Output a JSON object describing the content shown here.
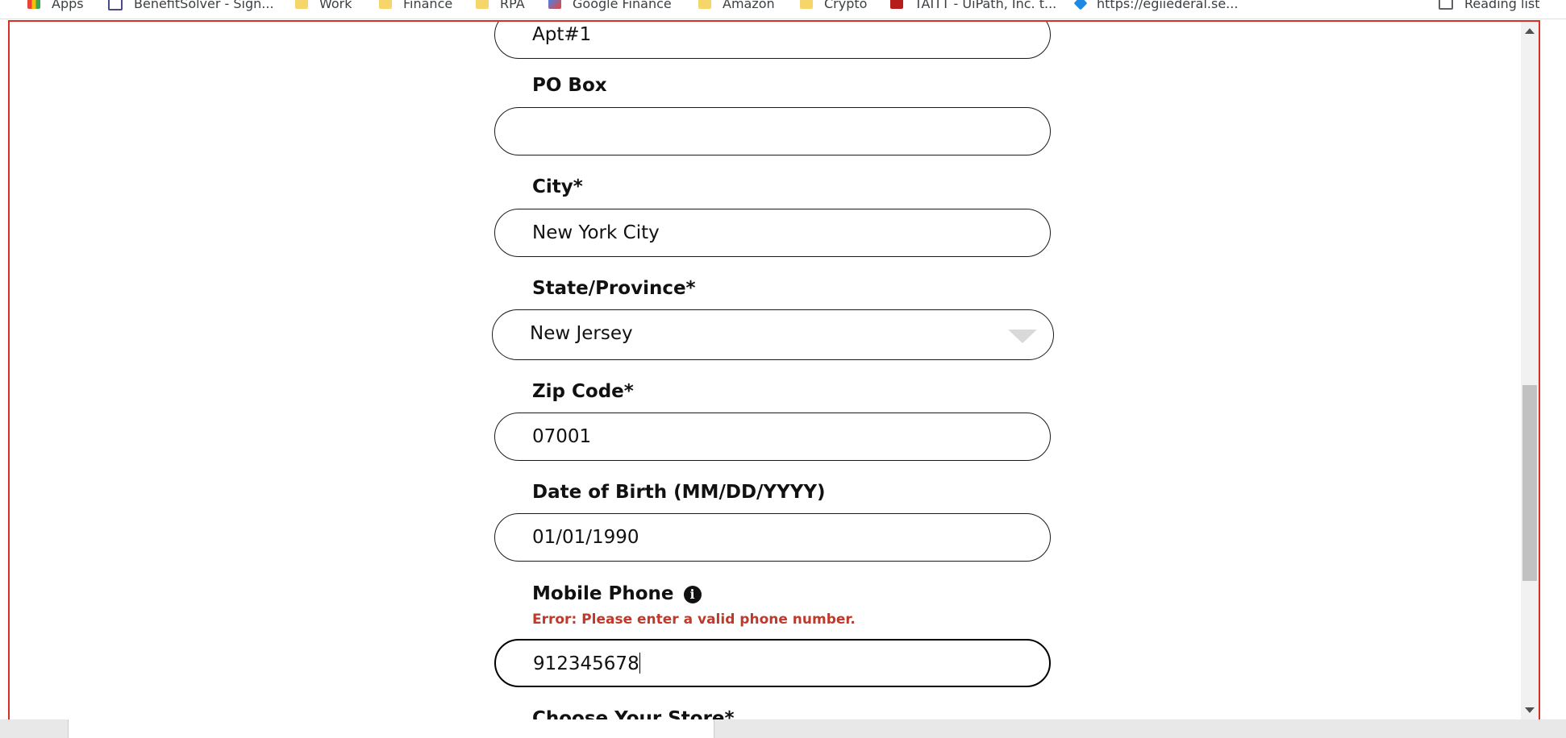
{
  "bookmarks": [
    {
      "label": "Apps",
      "icon": "apps-grid-icon"
    },
    {
      "label": "BenefitSolver - Sign...",
      "icon": "benefitsolver-icon"
    },
    {
      "label": "Work",
      "icon": "folder-icon"
    },
    {
      "label": "Finance",
      "icon": "folder-icon"
    },
    {
      "label": "RPA",
      "icon": "folder-icon"
    },
    {
      "label": "Google Finance",
      "icon": "google-finance-icon"
    },
    {
      "label": "Amazon",
      "icon": "folder-icon"
    },
    {
      "label": "Crypto",
      "icon": "folder-icon"
    },
    {
      "label": "TAITT - UiPath, Inc. t...",
      "icon": "tax-site-icon"
    },
    {
      "label": "https://egiiederal.se...",
      "icon": "federal-site-icon"
    },
    {
      "label": "Reading list",
      "icon": "reading-list-icon"
    }
  ],
  "form": {
    "apt": {
      "value": "Apt#1"
    },
    "po_box": {
      "label": "PO Box",
      "value": ""
    },
    "city": {
      "label": "City*",
      "value": "New York City"
    },
    "state": {
      "label": "State/Province*",
      "value": "New Jersey"
    },
    "zip": {
      "label": "Zip Code*",
      "value": "07001"
    },
    "dob": {
      "label": "Date of Birth (MM/DD/YYYY)",
      "value": "01/01/1990"
    },
    "phone": {
      "label": "Mobile Phone",
      "error": "Error: Please enter a valid phone number.",
      "value": "912345678"
    },
    "next_label": "Choose Your Store*"
  },
  "colors": {
    "error": "#c0392b",
    "frame_border": "#d93025",
    "input_border": "#1a1a1a"
  }
}
